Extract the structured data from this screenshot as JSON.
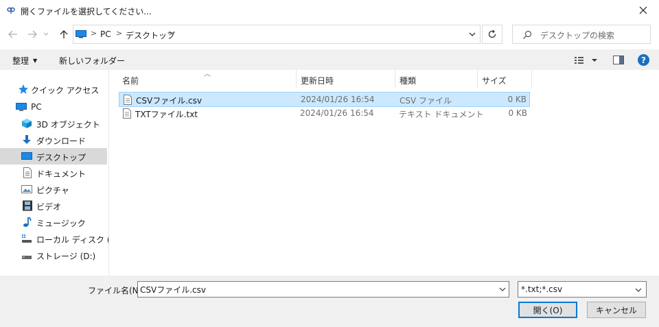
{
  "window": {
    "title": "開くファイルを選択してください..."
  },
  "address": {
    "segments": [
      "PC",
      "デスクトップ"
    ],
    "separator": ">"
  },
  "search": {
    "placeholder": "デスクトップの検索"
  },
  "toolbar": {
    "organize": "整理",
    "new_folder": "新しいフォルダー",
    "help": "?"
  },
  "nav": {
    "items": [
      {
        "label": "クイック アクセス",
        "icon": "star-icon"
      },
      {
        "label": "PC",
        "icon": "pc-icon"
      },
      {
        "label": "3D オブジェクト",
        "icon": "cube-icon"
      },
      {
        "label": "ダウンロード",
        "icon": "download-arrow-icon"
      },
      {
        "label": "デスクトップ",
        "icon": "desktop-icon",
        "selected": true
      },
      {
        "label": "ドキュメント",
        "icon": "document-icon"
      },
      {
        "label": "ピクチャ",
        "icon": "picture-icon"
      },
      {
        "label": "ビデオ",
        "icon": "film-icon"
      },
      {
        "label": "ミュージック",
        "icon": "music-note-icon"
      },
      {
        "label": "ローカル ディスク (C:)",
        "icon": "drive-icon"
      },
      {
        "label": "ストレージ (D:)",
        "icon": "drive-icon"
      }
    ]
  },
  "columns": {
    "name": "名前",
    "date": "更新日時",
    "type": "種類",
    "size": "サイズ"
  },
  "files": [
    {
      "name": "CSVファイル.csv",
      "date": "2024/01/26 16:54",
      "type": "CSV ファイル",
      "size": "0 KB",
      "selected": true
    },
    {
      "name": "TXTファイル.txt",
      "date": "2024/01/26 16:54",
      "type": "テキスト ドキュメント",
      "size": "0 KB"
    }
  ],
  "footer": {
    "filename_label": "ファイル名(N):",
    "filename_value": "CSVファイル.csv",
    "filter": "*.txt;*.csv",
    "open": "開く(O)",
    "cancel": "キャンセル"
  },
  "colors": {
    "accent": "#0078d7",
    "selection": "#cce8ff",
    "help": "#1a6fc0"
  }
}
